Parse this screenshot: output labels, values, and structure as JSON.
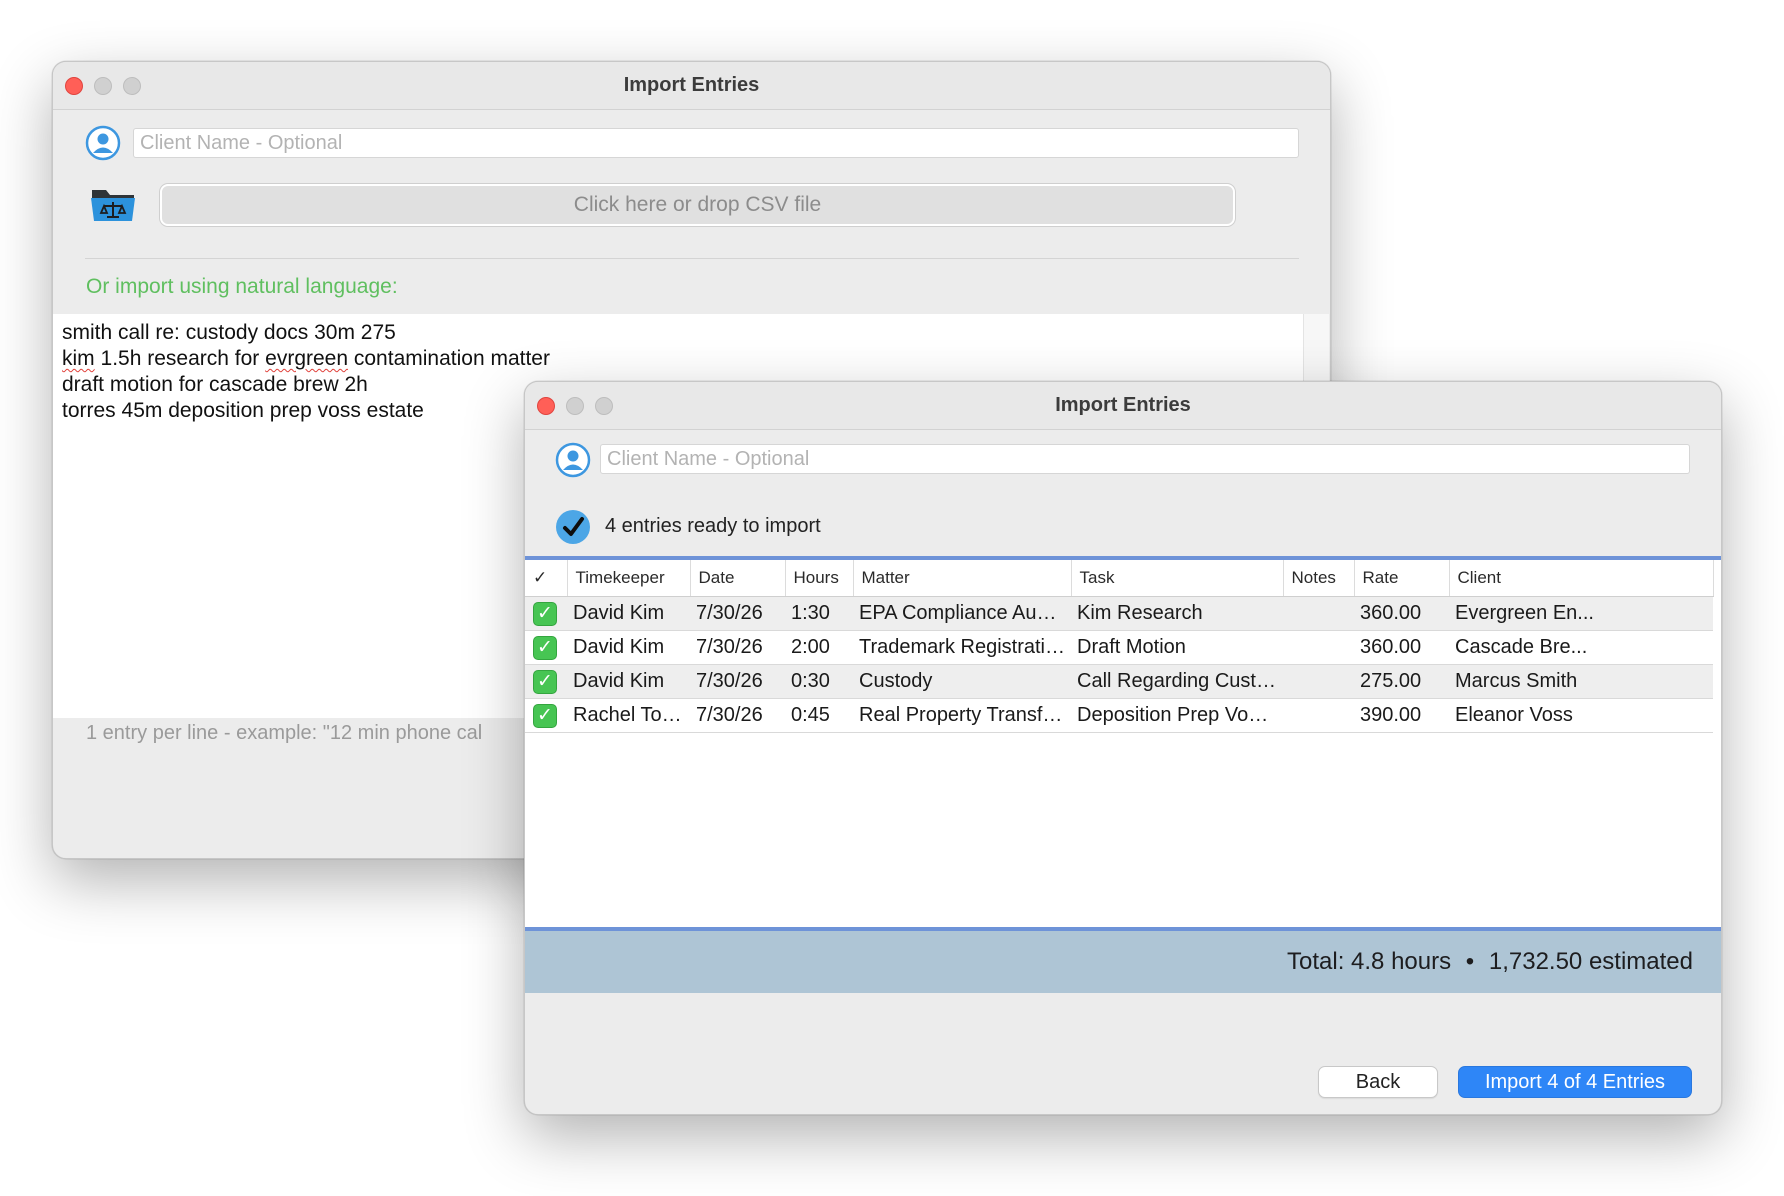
{
  "back_window": {
    "title": "Import Entries",
    "client_placeholder": "Client Name - Optional",
    "icons": {
      "client": "person-icon",
      "folder": "folder-scales-icon"
    },
    "csv_button_label": "Click here or drop CSV file",
    "natural_language_label": "Or import using natural language:",
    "natural_language_lines": [
      "smith call re: custody docs 30m 275",
      "kim 1.5h research for evrgreen contamination matter",
      "draft motion for cascade brew 2h",
      "torres 45m deposition prep voss estate"
    ],
    "hint": "1 entry per line - example: \"12 min phone cal"
  },
  "front_window": {
    "title": "Import Entries",
    "client_placeholder": "Client Name - Optional",
    "status_text": "4 entries ready to import",
    "columns": [
      "✓",
      "Timekeeper",
      "Date",
      "Hours",
      "Matter",
      "Task",
      "Notes",
      "Rate",
      "Client"
    ],
    "rows": [
      {
        "timekeeper": "David Kim",
        "date": "7/30/26",
        "hours": "1:30",
        "matter": "EPA Compliance Audit ...",
        "task": "Kim Research",
        "notes": "",
        "rate": "360.00",
        "client": "Evergreen En..."
      },
      {
        "timekeeper": "David Kim",
        "date": "7/30/26",
        "hours": "2:00",
        "matter": "Trademark Registration ...",
        "task": "Draft Motion",
        "notes": "",
        "rate": "360.00",
        "client": "Cascade Bre..."
      },
      {
        "timekeeper": "David Kim",
        "date": "7/30/26",
        "hours": "0:30",
        "matter": "Custody",
        "task": "Call Regarding Custod...",
        "notes": "",
        "rate": "275.00",
        "client": "Marcus Smith"
      },
      {
        "timekeeper": "Rachel Torres",
        "date": "7/30/26",
        "hours": "0:45",
        "matter": "Real Property Transfer -...",
        "task": "Deposition Prep Voss E...",
        "notes": "",
        "rate": "390.00",
        "client": "Eleanor Voss"
      }
    ],
    "total_hours": "Total: 4.8 hours",
    "total_separator": "•",
    "total_estimated": "1,732.50 estimated",
    "back_label": "Back",
    "import_label": "Import 4 of 4 Entries"
  },
  "colors": {
    "accent": "#2e86f7",
    "green_label": "#5fbf5f",
    "total_bar": "#aec5d5",
    "table_border": "#6e93d8",
    "checkbox": "#47c553"
  }
}
